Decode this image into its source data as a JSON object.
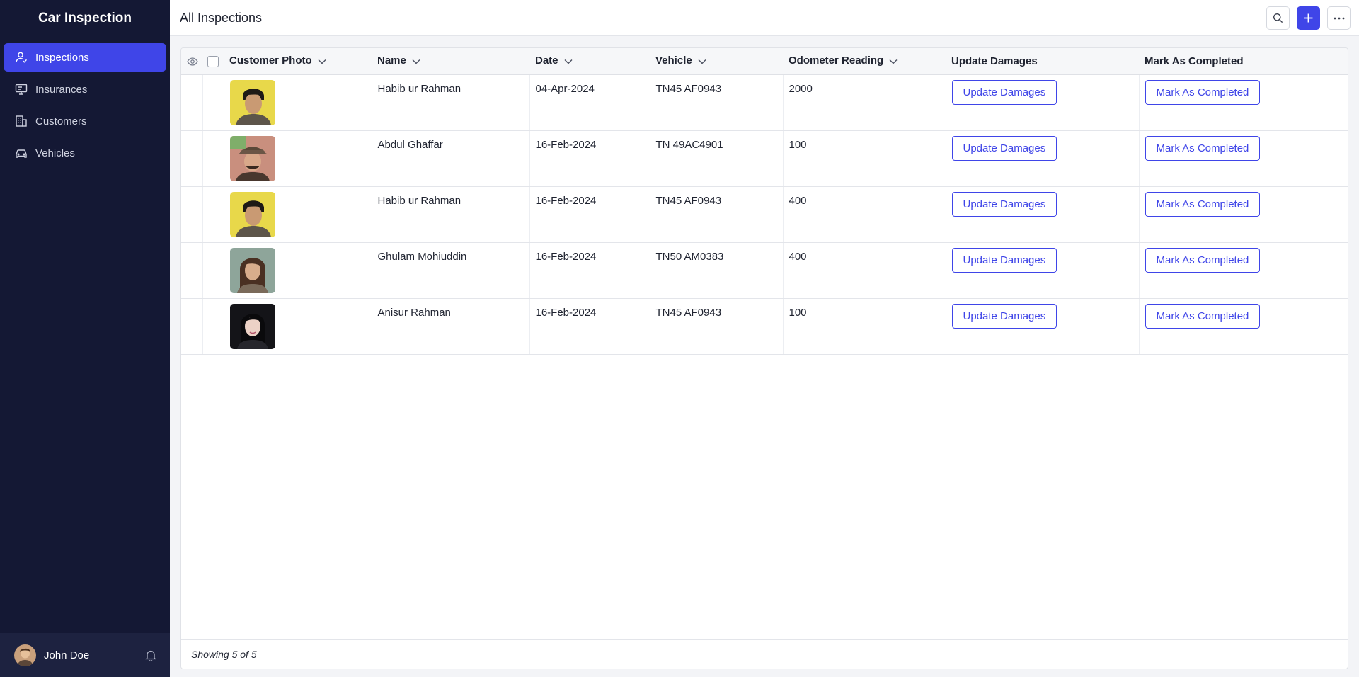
{
  "app": {
    "title": "Car Inspection"
  },
  "sidebar": {
    "items": [
      {
        "label": "Inspections",
        "icon": "user-check-icon",
        "active": true
      },
      {
        "label": "Insurances",
        "icon": "monitor-icon",
        "active": false
      },
      {
        "label": "Customers",
        "icon": "building-icon",
        "active": false
      },
      {
        "label": "Vehicles",
        "icon": "car-icon",
        "active": false
      }
    ],
    "user": {
      "name": "John Doe"
    }
  },
  "header": {
    "title": "All Inspections"
  },
  "table": {
    "columns": [
      "Customer Photo",
      "Name",
      "Date",
      "Vehicle",
      "Odometer Reading",
      "Update Damages",
      "Mark As Completed"
    ],
    "rows": [
      {
        "name": "Habib ur Rahman",
        "date": "04-Apr-2024",
        "vehicle": "TN45 AF0943",
        "odometer": "2000",
        "update_label": "Update Damages",
        "complete_label": "Mark As Completed"
      },
      {
        "name": "Abdul Ghaffar",
        "date": "16-Feb-2024",
        "vehicle": "TN 49AC4901",
        "odometer": "100",
        "update_label": "Update Damages",
        "complete_label": "Mark As Completed"
      },
      {
        "name": "Habib ur Rahman",
        "date": "16-Feb-2024",
        "vehicle": "TN45 AF0943",
        "odometer": "400",
        "update_label": "Update Damages",
        "complete_label": "Mark As Completed"
      },
      {
        "name": "Ghulam Mohiuddin",
        "date": "16-Feb-2024",
        "vehicle": "TN50 AM0383",
        "odometer": "400",
        "update_label": "Update Damages",
        "complete_label": "Mark As Completed"
      },
      {
        "name": "Anisur Rahman",
        "date": "16-Feb-2024",
        "vehicle": "TN45 AF0943",
        "odometer": "100",
        "update_label": "Update Damages",
        "complete_label": "Mark As Completed"
      }
    ]
  },
  "footer": {
    "text": "Showing 5 of 5"
  },
  "colors": {
    "sidebar_bg": "#141834",
    "accent": "#3f45e8"
  }
}
